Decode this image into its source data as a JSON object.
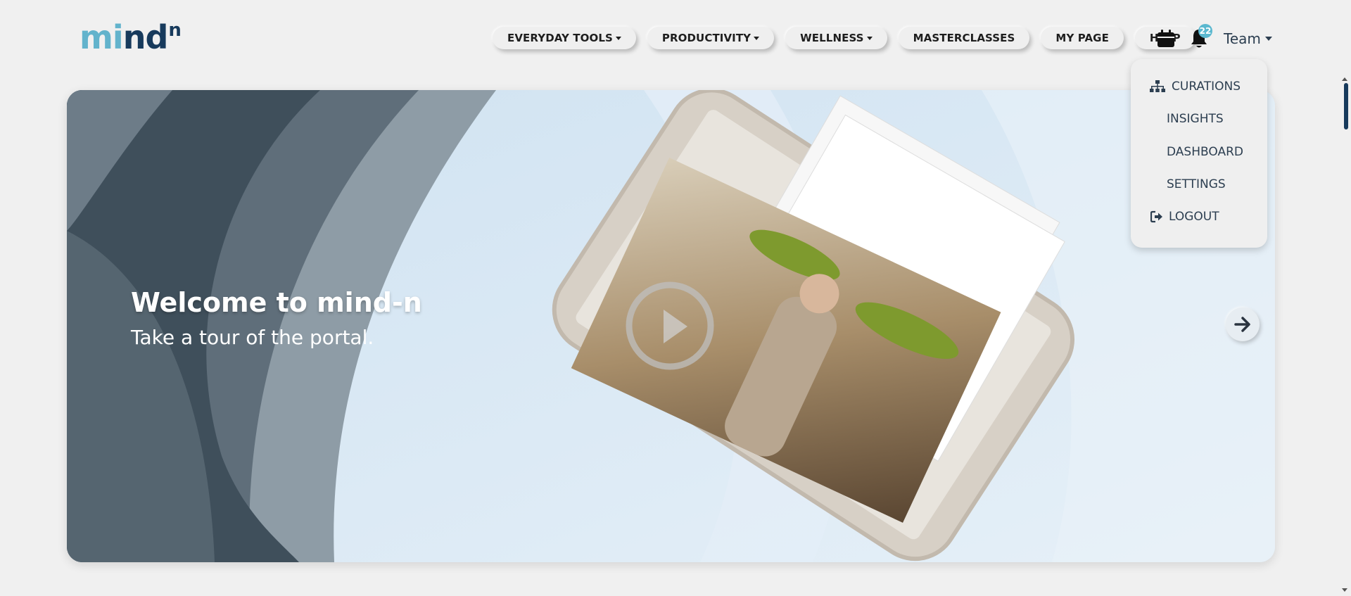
{
  "logo": {
    "text_part1": "mi",
    "text_part2": "nd",
    "superscript": "n"
  },
  "nav": {
    "items": [
      {
        "label": "EVERYDAY TOOLS",
        "has_caret": true
      },
      {
        "label": "PRODUCTIVITY",
        "has_caret": true
      },
      {
        "label": "WELLNESS",
        "has_caret": true
      },
      {
        "label": "MASTERCLASSES",
        "has_caret": false
      },
      {
        "label": "MY PAGE",
        "has_caret": false
      },
      {
        "label": "HELP",
        "has_caret": false
      }
    ],
    "calendar_icon": "calendar-icon",
    "bell_icon": "bell-icon",
    "notification_count": "22",
    "user_menu_label": "Team"
  },
  "dropdown": {
    "items": [
      {
        "label": "CURATIONS",
        "icon": "sitemap-icon"
      },
      {
        "label": "INSIGHTS",
        "icon": ""
      },
      {
        "label": "DASHBOARD",
        "icon": ""
      },
      {
        "label": "SETTINGS",
        "icon": ""
      },
      {
        "label": "LOGOUT",
        "icon": "logout-icon"
      }
    ]
  },
  "hero": {
    "title": "Welcome to mind-n",
    "subtitle": "Take a tour of the portal.",
    "next_icon": "arrow-right-icon"
  },
  "colors": {
    "brand_teal": "#62b3cc",
    "brand_navy": "#173a5c",
    "badge": "#5bb8cf",
    "page_bg": "#f0f0f0"
  }
}
